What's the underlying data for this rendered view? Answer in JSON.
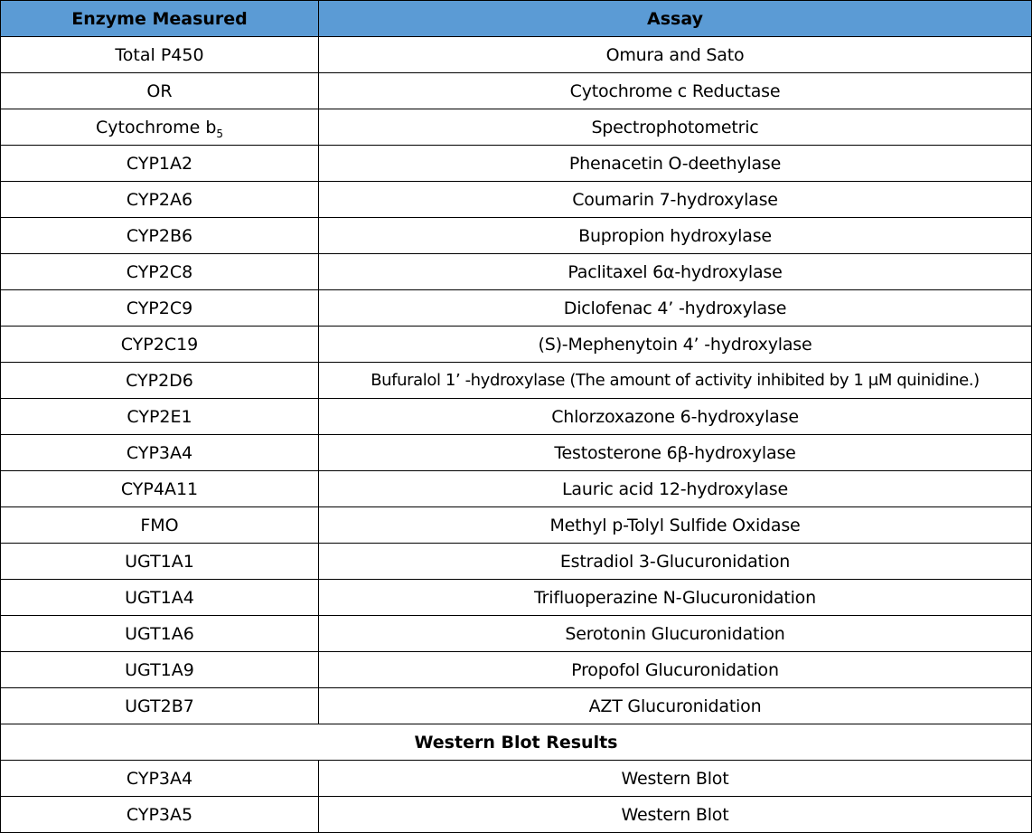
{
  "table": {
    "headers": {
      "enzyme": "Enzyme Measured",
      "assay": "Assay"
    },
    "rows": [
      {
        "enzyme": "Total P450",
        "assay": "Omura and Sato"
      },
      {
        "enzyme": "OR",
        "assay": "Cytochrome c Reductase"
      },
      {
        "enzyme": "Cytochrome b",
        "enzyme_sub": "5",
        "assay": "Spectrophotometric"
      },
      {
        "enzyme": "CYP1A2",
        "assay": "Phenacetin O-deethylase"
      },
      {
        "enzyme": "CYP2A6",
        "assay": "Coumarin 7-hydroxylase"
      },
      {
        "enzyme": "CYP2B6",
        "assay": "Bupropion hydroxylase"
      },
      {
        "enzyme": "CYP2C8",
        "assay": "Paclitaxel 6α-hydroxylase"
      },
      {
        "enzyme": "CYP2C9",
        "assay": "Diclofenac 4’ -hydroxylase"
      },
      {
        "enzyme": "CYP2C19",
        "assay": "(S)-Mephenytoin 4’ -hydroxylase"
      },
      {
        "enzyme": "CYP2D6",
        "assay": "Bufuralol 1’ -hydroxylase (The amount of activity inhibited by 1 μM quinidine.)"
      },
      {
        "enzyme": "CYP2E1",
        "assay": "Chlorzoxazone 6-hydroxylase"
      },
      {
        "enzyme": "CYP3A4",
        "assay": "Testosterone 6β-hydroxylase"
      },
      {
        "enzyme": "CYP4A11",
        "assay": "Lauric acid 12-hydroxylase"
      },
      {
        "enzyme": "FMO",
        "assay": "Methyl p-Tolyl Sulfide Oxidase"
      },
      {
        "enzyme": "UGT1A1",
        "assay": "Estradiol 3-Glucuronidation"
      },
      {
        "enzyme": "UGT1A4",
        "assay": "Trifluoperazine N-Glucuronidation"
      },
      {
        "enzyme": "UGT1A6",
        "assay": "Serotonin Glucuronidation"
      },
      {
        "enzyme": "UGT1A9",
        "assay": "Propofol Glucuronidation"
      },
      {
        "enzyme": "UGT2B7",
        "assay": "AZT Glucuronidation"
      }
    ],
    "section_title": "Western Blot Results",
    "section_rows": [
      {
        "enzyme": "CYP3A4",
        "assay": "Western Blot"
      },
      {
        "enzyme": "CYP3A5",
        "assay": "Western Blot"
      }
    ]
  },
  "colors": {
    "header_background": "#5b9bd5",
    "border": "#000000",
    "text": "#000000"
  }
}
